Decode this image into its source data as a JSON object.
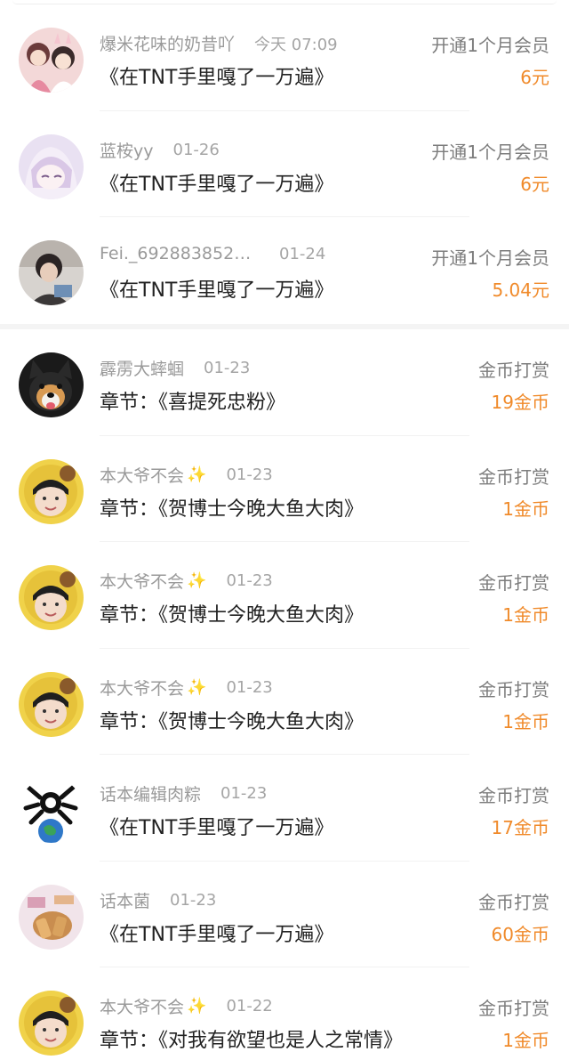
{
  "colors": {
    "amount": "#f08a2a",
    "name": "#9a9a9a",
    "text": "#222222",
    "type": "#7d7d7d",
    "sparkle": "#f2c230"
  },
  "records": [
    {
      "name": "爆米花味的奶昔吖",
      "sparkle": false,
      "date": "今天 07:09",
      "content": "《在TNT手里嘎了一万遍》",
      "type": "开通1个月会员",
      "amount": "6元",
      "avatar": "anime-couple-avatar"
    },
    {
      "name": "蓝桉yy",
      "sparkle": false,
      "date": "01-26",
      "content": "《在TNT手里嘎了一万遍》",
      "type": "开通1个月会员",
      "amount": "6元",
      "avatar": "anime-girl-avatar"
    },
    {
      "name": "Fei._6928838521...",
      "sparkle": false,
      "date": "01-24",
      "content": "《在TNT手里嘎了一万遍》",
      "type": "开通1个月会员",
      "amount": "5.04元",
      "avatar": "photo-boy-avatar"
    },
    {
      "name": "霹雳大蟀蝈",
      "sparkle": false,
      "date": "01-23",
      "content": "章节：《喜提死忠粉》",
      "type": "金币打赏",
      "amount": "19金币",
      "avatar": "shiba-dog-avatar"
    },
    {
      "name": "本大爷不会",
      "sparkle": true,
      "date": "01-23",
      "content": "章节：《贺博士今晚大鱼大肉》",
      "type": "金币打赏",
      "amount": "1金币",
      "avatar": "face-yellow-avatar"
    },
    {
      "name": "本大爷不会",
      "sparkle": true,
      "date": "01-23",
      "content": "章节：《贺博士今晚大鱼大肉》",
      "type": "金币打赏",
      "amount": "1金币",
      "avatar": "face-yellow-avatar"
    },
    {
      "name": "本大爷不会",
      "sparkle": true,
      "date": "01-23",
      "content": "章节：《贺博士今晚大鱼大肉》",
      "type": "金币打赏",
      "amount": "1金币",
      "avatar": "face-yellow-avatar"
    },
    {
      "name": "话本编辑肉粽",
      "sparkle": false,
      "date": "01-23",
      "content": "《在TNT手里嘎了一万遍》",
      "type": "金币打赏",
      "amount": "17金币",
      "avatar": "skull-earth-avatar"
    },
    {
      "name": "话本菌",
      "sparkle": false,
      "date": "01-23",
      "content": "《在TNT手里嘎了一万遍》",
      "type": "金币打赏",
      "amount": "60金币",
      "avatar": "pastry-avatar"
    },
    {
      "name": "本大爷不会",
      "sparkle": true,
      "date": "01-22",
      "content": "章节：《对我有欲望也是人之常情》",
      "type": "金币打赏",
      "amount": "1金币",
      "avatar": "face-yellow-avatar"
    }
  ]
}
